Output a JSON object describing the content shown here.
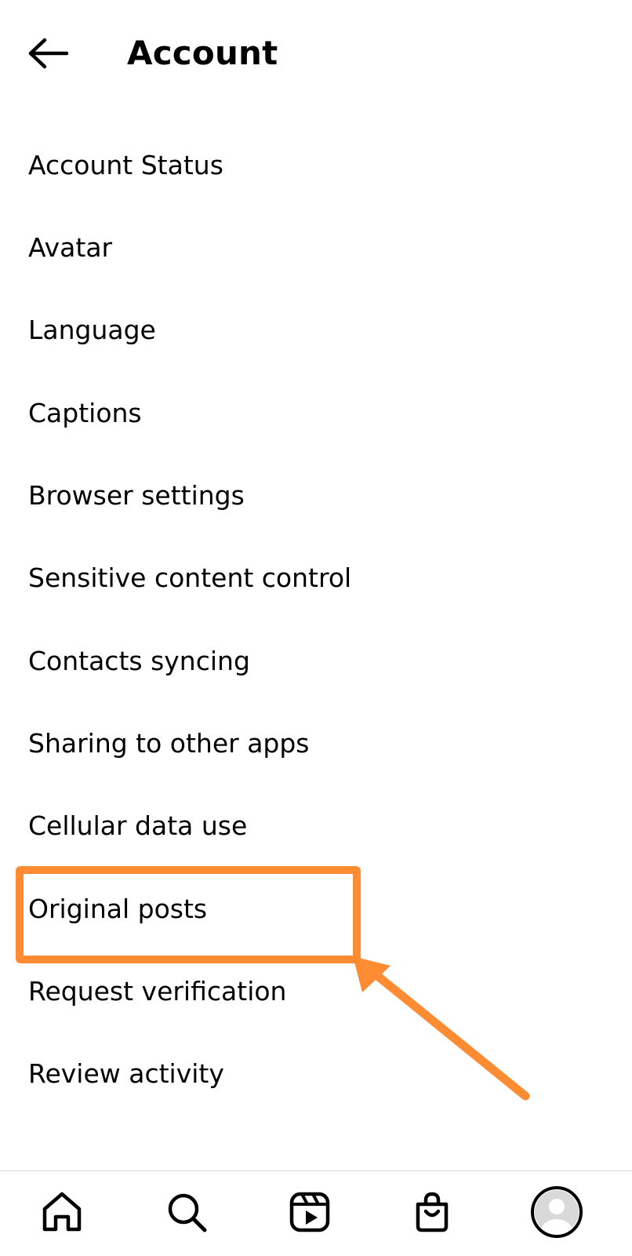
{
  "header": {
    "title": "Account",
    "back_icon": "arrow-left-icon"
  },
  "menu": {
    "items": [
      {
        "label": "Account Status"
      },
      {
        "label": "Avatar"
      },
      {
        "label": "Language"
      },
      {
        "label": "Captions"
      },
      {
        "label": "Browser settings"
      },
      {
        "label": "Sensitive content control"
      },
      {
        "label": "Contacts syncing"
      },
      {
        "label": "Sharing to other apps"
      },
      {
        "label": "Cellular data use"
      },
      {
        "label": "Original posts"
      },
      {
        "label": "Request verification"
      },
      {
        "label": "Review activity"
      }
    ]
  },
  "annotation": {
    "color": "#ff8c33",
    "highlighted_item": "Original posts"
  },
  "bottom_nav": {
    "items": [
      {
        "icon": "home-icon"
      },
      {
        "icon": "search-icon"
      },
      {
        "icon": "reels-icon"
      },
      {
        "icon": "shop-icon"
      },
      {
        "icon": "profile-avatar"
      }
    ]
  }
}
